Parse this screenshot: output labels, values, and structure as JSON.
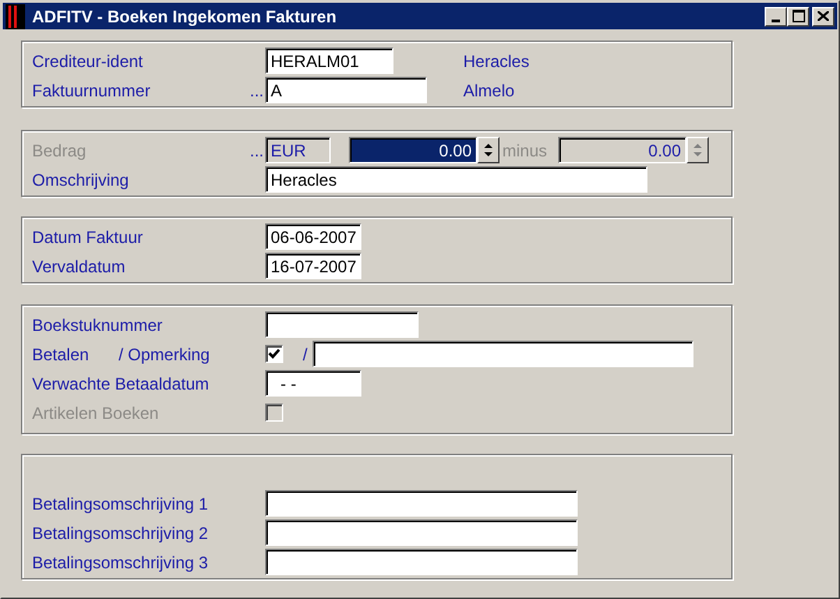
{
  "window": {
    "title": "ADFITV - Boeken Ingekomen Fakturen"
  },
  "crediteur": {
    "label": "Crediteur-ident",
    "value": "HERALM01",
    "name": "Heracles"
  },
  "faktuur": {
    "label": "Faktuurnummer",
    "dots": "...",
    "value": "A",
    "city": "Almelo"
  },
  "bedrag": {
    "label": "Bedrag",
    "disabled": true,
    "dots": "...",
    "currency": "EUR",
    "amount": "0.00",
    "highlighted": true,
    "minus_label": "minus",
    "minus_amount": "0.00"
  },
  "omschrijving": {
    "label": "Omschrijving",
    "value": "Heracles"
  },
  "datum_faktuur": {
    "label": "Datum Faktuur",
    "value": "06-06-2007"
  },
  "vervaldatum": {
    "label": "Vervaldatum",
    "value": "16-07-2007"
  },
  "boekstuknummer": {
    "label": "Boekstuknummer"
  },
  "betalen": {
    "label": "Betalen",
    "label_2": "/ Opmerking",
    "checked": true,
    "separator": "/"
  },
  "verwachte": {
    "label": "Verwachte Betaaldatum",
    "value": "- -"
  },
  "artikelen": {
    "label": "Artikelen Boeken",
    "disabled": true,
    "checked": false
  },
  "betalingsomschrijving": [
    {
      "label": "Betalingsomschrijving 1"
    },
    {
      "label": "Betalingsomschrijving 2"
    },
    {
      "label": "Betalingsomschrijving 3"
    }
  ]
}
